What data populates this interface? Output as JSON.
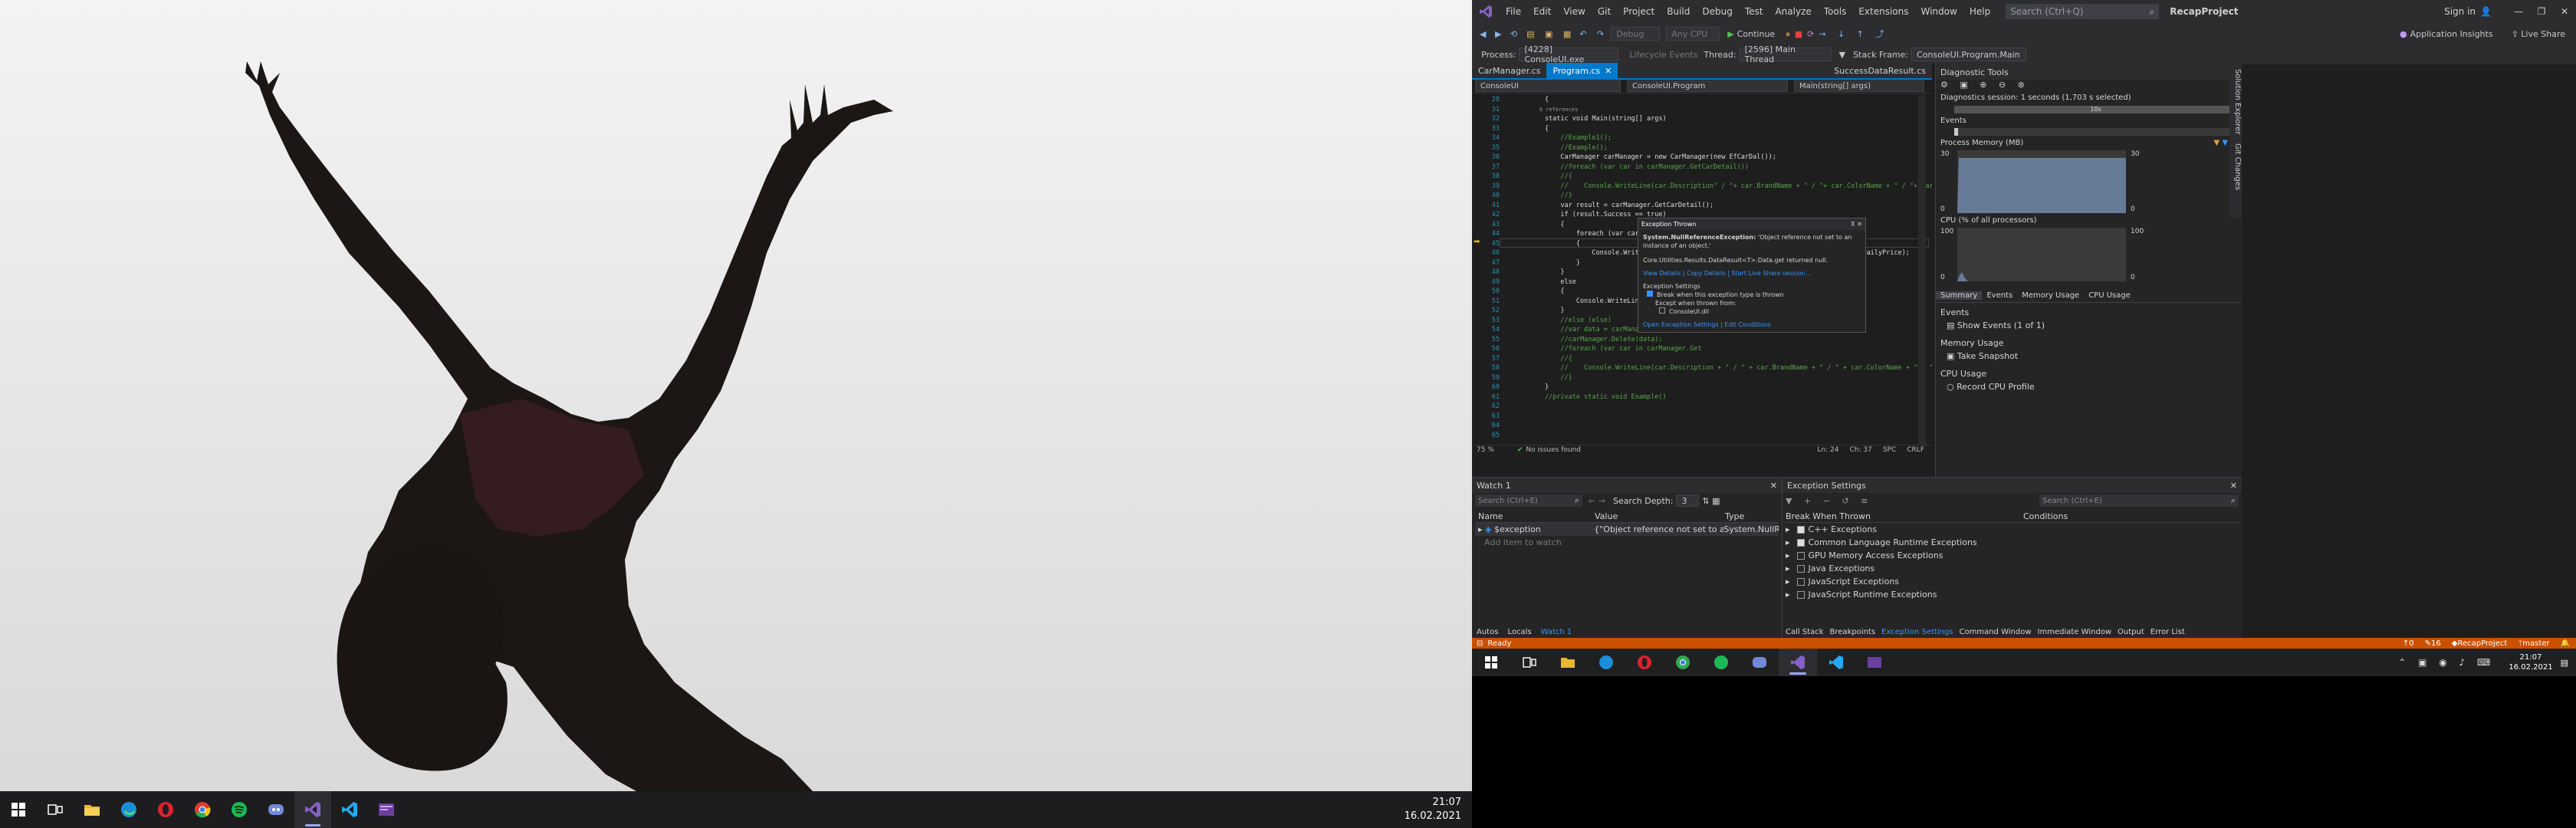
{
  "left_taskbar": {
    "time": "21:07",
    "date": "16.02.2021"
  },
  "vs": {
    "menu": [
      "File",
      "Edit",
      "View",
      "Git",
      "Project",
      "Build",
      "Debug",
      "Test",
      "Analyze",
      "Tools",
      "Extensions",
      "Window",
      "Help"
    ],
    "search_placeholder": "Search (Ctrl+Q)",
    "solution_name": "RecapProject",
    "sign_in": "Sign in",
    "toolbar": {
      "debug_dd": "Debug",
      "cpu_dd": "Any CPU",
      "continue": "Continue",
      "app_insights": "Application Insights",
      "live_share": "Live Share"
    },
    "process_bar": {
      "process_label": "Process:",
      "process": "[4228] ConsoleUI.exe",
      "lifecycle": "Lifecycle Events",
      "thread_label": "Thread:",
      "thread": "[2596] Main Thread",
      "stack_label": "Stack Frame:",
      "stack": "ConsoleUI.Program.Main"
    },
    "doc_tabs": [
      "CarManager.cs",
      "Program.cs",
      "SuccessDataResult.cs"
    ],
    "nav": {
      "project": "ConsoleUI",
      "class": "ConsoleUI.Program",
      "member": "Main(string[] args)"
    },
    "code_lines": [
      {
        "n": "28",
        "t": "        {"
      },
      {
        "n": "",
        "t": "        0 references"
      },
      {
        "n": "31",
        "t": "        static void Main(string[] args)"
      },
      {
        "n": "32",
        "t": "        {"
      },
      {
        "n": "33",
        "t": "            //Example1();"
      },
      {
        "n": "34",
        "t": ""
      },
      {
        "n": "35",
        "t": "            //Example();"
      },
      {
        "n": "36",
        "t": "            CarManager carManager = new CarManager(new EfCarDal());"
      },
      {
        "n": "37",
        "t": "            //foreach (var car in carManager.GetCarDetail())"
      },
      {
        "n": "38",
        "t": "            //{"
      },
      {
        "n": "39",
        "t": "            //    Console.WriteLine(car.Description\" / \"+ car.BrandName + \" / \"+ car.ColorName + \" / \"+ car.DailyPrice);"
      },
      {
        "n": "40",
        "t": "            //}"
      },
      {
        "n": "41",
        "t": "            var result = carManager.GetCarDetail();"
      },
      {
        "n": "42",
        "t": "            if (result.Success == true)"
      },
      {
        "n": "43",
        "t": "            {"
      },
      {
        "n": "44",
        "t": "                foreach (var car in result.Data)"
      },
      {
        "n": "45",
        "t": "                {"
      },
      {
        "n": "46",
        "t": "                    Console.WriteLine(car.Descrip                              / \" + car.DailyPrice);"
      },
      {
        "n": "47",
        "t": "                }"
      },
      {
        "n": "48",
        "t": "            }"
      },
      {
        "n": "49",
        "t": "            else"
      },
      {
        "n": "50",
        "t": "            {"
      },
      {
        "n": "51",
        "t": "                Console.WriteLine(result.Message)"
      },
      {
        "n": "52",
        "t": "            }"
      },
      {
        "n": "53",
        "t": ""
      },
      {
        "n": "54",
        "t": "            //else (else)"
      },
      {
        "n": "55",
        "t": "            //var data = carManager.GetbyId(1);"
      },
      {
        "n": "56",
        "t": "            //carManager.Delete(data);"
      },
      {
        "n": "57",
        "t": ""
      },
      {
        "n": "58",
        "t": "            //foreach (var car in carManager.Get"
      },
      {
        "n": "59",
        "t": "            //{"
      },
      {
        "n": "60",
        "t": "            //    Console.WriteLine(car.Description + \" / \" + car.BrandName + \" / \" + car.ColorName + \" / \" + car.DailyPrice);"
      },
      {
        "n": "61",
        "t": "            //}"
      },
      {
        "n": "62",
        "t": ""
      },
      {
        "n": "63",
        "t": "        }"
      },
      {
        "n": "64",
        "t": ""
      },
      {
        "n": "65",
        "t": "        //private static void Example()"
      }
    ],
    "exception": {
      "title": "Exception Thrown",
      "type": "System.NullReferenceException:",
      "msg": "'Object reference not set to an instance of an object.'",
      "detail": "Core.Utilities.Results.DataResult<T>.Data.get returned null.",
      "links": [
        "View Details",
        "Copy Details",
        "Start Live Share session..."
      ],
      "settings_title": "Exception Settings",
      "s1": "Break when this exception type is thrown",
      "s2": "Except when thrown from:",
      "s3": "ConsoleUI.dll",
      "bottom_links": [
        "Open Exception Settings",
        "Edit Conditions"
      ]
    },
    "editor_status": {
      "zoom": "75 %",
      "issues": "No issues found",
      "ln": "Ln: 24",
      "ch": "Ch: 37",
      "spc": "SPC",
      "crlf": "CRLF"
    },
    "watch": {
      "title": "Watch 1",
      "search_placeholder": "Search (Ctrl+E)",
      "depth_label": "Search Depth:",
      "depth": "3",
      "cols": [
        "Name",
        "Value",
        "Type"
      ],
      "rows": [
        {
          "name": "$exception",
          "value": "{\"Object reference not set to an instance of an object.\"}",
          "type": "System.NullRefere..."
        }
      ],
      "add": "Add item to watch",
      "tabs": [
        "Autos",
        "Locals",
        "Watch 1"
      ]
    },
    "exc_settings": {
      "title": "Exception Settings",
      "search_placeholder": "Search (Ctrl+E)",
      "cols": [
        "Break When Thrown",
        "Conditions"
      ],
      "items": [
        "C++ Exceptions",
        "Common Language Runtime Exceptions",
        "GPU Memory Access Exceptions",
        "Java Exceptions",
        "JavaScript Exceptions",
        "JavaScript Runtime Exceptions"
      ],
      "tabs": [
        "Call Stack",
        "Breakpoints",
        "Exception Settings",
        "Command Window",
        "Immediate Window",
        "Output",
        "Error List"
      ]
    },
    "diag": {
      "title": "Diagnostic Tools",
      "session": "Diagnostics session: 1 seconds (1,703 s selected)",
      "tick": "10s",
      "events": "Events",
      "mem": "Process Memory (MB)",
      "mem_max": "30",
      "mem_min": "0",
      "cpu": "CPU (% of all processors)",
      "cpu_max": "100",
      "cpu_min": "0",
      "tabs": [
        "Summary",
        "Events",
        "Memory Usage",
        "CPU Usage"
      ],
      "sec_events": "Events",
      "show_events": "Show Events (1 of 1)",
      "sec_mem": "Memory Usage",
      "snapshot": "Take Snapshot",
      "sec_cpu": "CPU Usage",
      "record": "Record CPU Profile",
      "side": [
        "Solution Explorer",
        "Git Changes"
      ]
    },
    "status": {
      "ready": "Ready",
      "up": "0",
      "edits": "16",
      "project": "RecapProject",
      "branch": "master"
    }
  },
  "right_taskbar": {
    "time": "21:07",
    "date": "16.02.2021"
  }
}
